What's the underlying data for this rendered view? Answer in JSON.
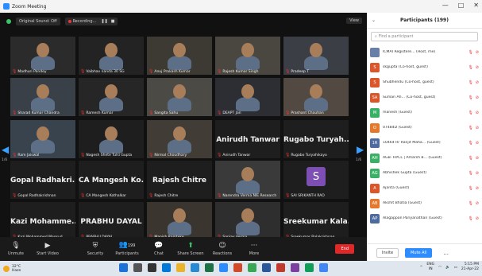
{
  "window": {
    "title": "Zoom Meeting",
    "controls": [
      "—",
      "□",
      "✕"
    ]
  },
  "meeting_top": {
    "security_label": "Original Sound: Off",
    "recording_label": "Recording...",
    "view_label": "View"
  },
  "tiles": [
    {
      "name": "Madhuri Pandey",
      "big": ""
    },
    {
      "name": "Vaibhav nanda 30 SG",
      "big": ""
    },
    {
      "name": "Anuj Prakash Kumar",
      "big": ""
    },
    {
      "name": "Rajesh Kumar Singh",
      "big": ""
    },
    {
      "name": "Pradeep T",
      "big": ""
    },
    {
      "name": "Sharad Kumar Chandra",
      "big": ""
    },
    {
      "name": "Ramesh Kumar",
      "big": ""
    },
    {
      "name": "Sangita Sahu",
      "big": ""
    },
    {
      "name": "DEAPT Jan",
      "big": ""
    },
    {
      "name": "Prashant Chauhan",
      "big": ""
    },
    {
      "name": "Ram Jaiswal",
      "big": ""
    },
    {
      "name": "Nagesh Shete Tulsi Gupta",
      "big": ""
    },
    {
      "name": "Nirmal Choudhary",
      "big": ""
    },
    {
      "name": "Anirudh Tanwar",
      "big": "Anirudh Tanwar"
    },
    {
      "name": "Rugabo Turyahikayo",
      "big": "Rugabo Turyah..."
    },
    {
      "name": "Gopal Radhakrishnan",
      "big": "Gopal Radhakri..."
    },
    {
      "name": "CA Mangesh Kothalkar",
      "big": "CA Mangesh Ko..."
    },
    {
      "name": "Rajesh Chitre",
      "big": "Rajesh Chitre"
    },
    {
      "name": "Narendra Verma NIE Research",
      "big": ""
    },
    {
      "name": "SAI SRIKANTH RAO",
      "big": "S"
    },
    {
      "name": "Kazi Mohammed Maqsud",
      "big": "Kazi Mohamme..."
    },
    {
      "name": "PRABHU DAYAL",
      "big": "PRABHU DAYAL"
    },
    {
      "name": "Manish Ramteke",
      "big": ""
    },
    {
      "name": "Sanjay Verma",
      "big": ""
    },
    {
      "name": "Sreekumar Balakrishnan",
      "big": "Sreekumar Kala..."
    }
  ],
  "nav": {
    "prev_page": "1/6",
    "next_page": "1/6"
  },
  "toolbar": {
    "items": [
      "Unmute",
      "Start Video",
      "Security",
      "Participants",
      "Chat",
      "Share Screen",
      "Reactions",
      "More"
    ],
    "participant_count": "199",
    "end_label": "End"
  },
  "panel": {
    "title": "Participants (199)",
    "search_placeholder": "Find a participant",
    "participants": [
      {
        "initials": "",
        "name": "ICMAI Registere... (Host, me)",
        "color": "#6a7fa8"
      },
      {
        "initials": "S",
        "name": "skgupta (Co-host, guest)",
        "color": "#d9572a"
      },
      {
        "initials": "S",
        "name": "Shubhendu (Co-host, guest)",
        "color": "#d9572a"
      },
      {
        "initials": "SA",
        "name": "Suman Ah... (Co-host, guest)",
        "color": "#d9572a"
      },
      {
        "initials": "M",
        "name": "manesh (Guest)",
        "color": "#3ab066"
      },
      {
        "initials": "O",
        "name": "07484D (Guest)",
        "color": "#e4792d"
      },
      {
        "initials": "1R",
        "name": "10464 Rr Ranjit Maha... (Guest)",
        "color": "#4d6b9e"
      },
      {
        "initials": "AH",
        "name": "AGB- HPCL | Amarsh B... (Guest)",
        "color": "#3ab066"
      },
      {
        "initials": "AG",
        "name": "Abhishek Gupta (Guest)",
        "color": "#3ab066"
      },
      {
        "initials": "A",
        "name": "Ajanta (Guest)",
        "color": "#d9572a"
      },
      {
        "initials": "AB",
        "name": "Akshit Bhatia (Guest)",
        "color": "#e4792d"
      },
      {
        "initials": "AP",
        "name": "Alagappan Pariyanathan (Guest)",
        "color": "#4d6b9e"
      }
    ],
    "invite_label": "Invite",
    "mute_all_label": "Mute All",
    "more_label": "..."
  },
  "taskbar": {
    "temp": "32°C",
    "weather": "Haze",
    "lang": "ENG",
    "region": "IN",
    "time": "5:15 PM",
    "date": "21-Apr-22"
  }
}
